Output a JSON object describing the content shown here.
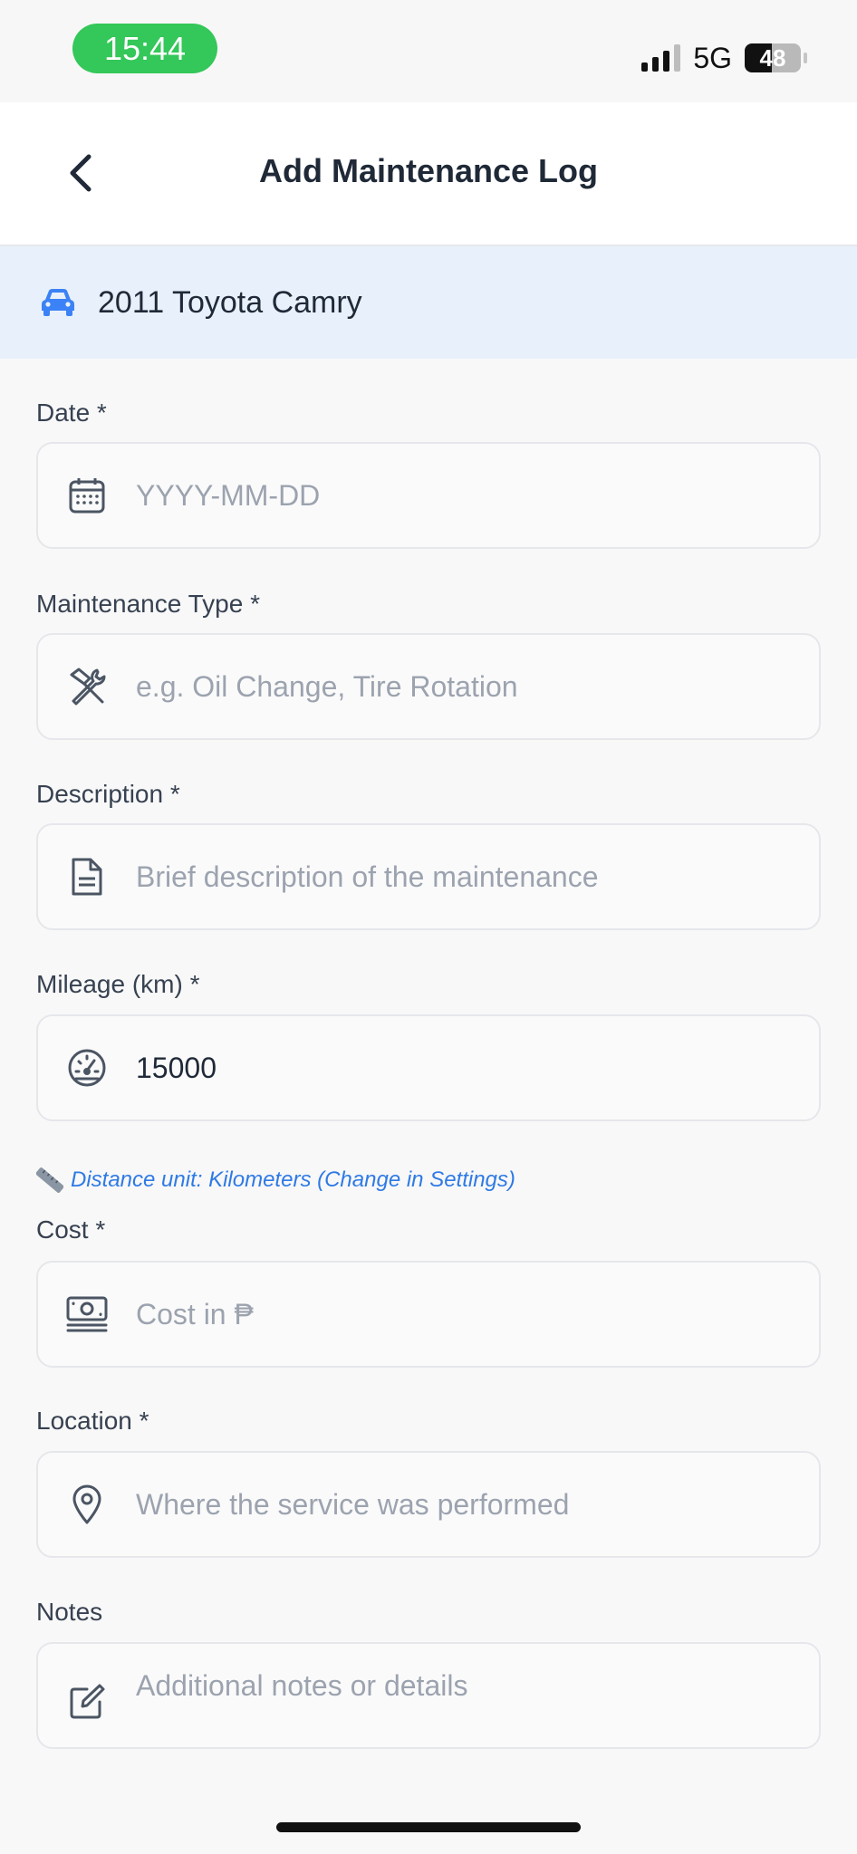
{
  "status_bar": {
    "time": "15:44",
    "network": "5G",
    "battery": "48"
  },
  "header": {
    "title": "Add Maintenance Log",
    "back_icon": "chevron-left-icon"
  },
  "vehicle": {
    "name": "2011 Toyota Camry",
    "icon": "car-icon"
  },
  "form": {
    "date": {
      "label": "Date *",
      "placeholder": "YYYY-MM-DD",
      "value": "",
      "icon": "calendar-icon"
    },
    "maintenance_type": {
      "label": "Maintenance Type *",
      "placeholder": "e.g. Oil Change, Tire Rotation",
      "value": "",
      "icon": "tools-icon"
    },
    "description": {
      "label": "Description *",
      "placeholder": "Brief description of the maintenance",
      "value": "",
      "icon": "document-icon"
    },
    "mileage": {
      "label": "Mileage (km) *",
      "placeholder": "",
      "value": "15000",
      "icon": "speedometer-icon"
    },
    "unit_hint": {
      "text": "Distance unit: Kilometers (Change in Settings)",
      "icon": "ruler-icon"
    },
    "cost": {
      "label": "Cost *",
      "placeholder": "Cost in ₱",
      "value": "",
      "icon": "money-icon"
    },
    "location": {
      "label": "Location *",
      "placeholder": "Where the service was performed",
      "value": "",
      "icon": "location-pin-icon"
    },
    "notes": {
      "label": "Notes",
      "placeholder": "Additional notes or details",
      "value": "",
      "icon": "edit-icon"
    }
  },
  "colors": {
    "accent": "#2f7ae5",
    "banner_bg": "#e8f1fb",
    "time_pill": "#34c759",
    "placeholder": "#9ca3af"
  }
}
